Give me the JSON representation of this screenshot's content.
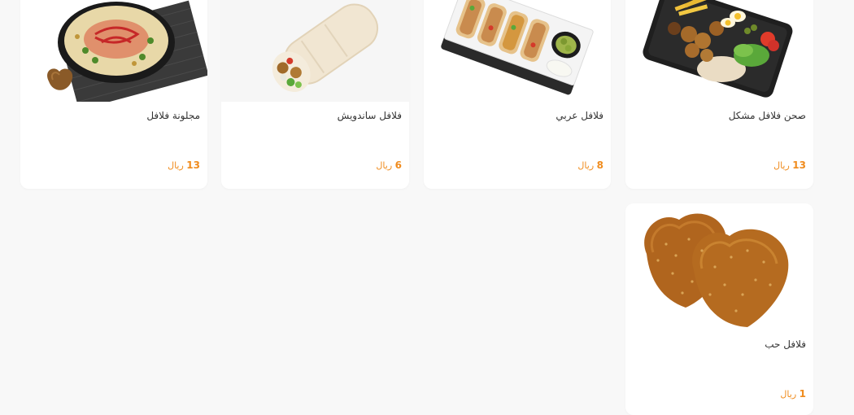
{
  "products": [
    {
      "name": "صحن فلافل مشكل",
      "price": "13",
      "currency": "ريال",
      "icon": "falafel-platter-image"
    },
    {
      "name": "فلافل عربي",
      "price": "8",
      "currency": "ريال",
      "icon": "arabic-falafel-box-image"
    },
    {
      "name": "فلافل ساندويش",
      "price": "6",
      "currency": "ريال",
      "icon": "falafel-wrap-image"
    },
    {
      "name": "مجلونة فلافل",
      "price": "13",
      "currency": "ريال",
      "icon": "falafel-bowl-image"
    },
    {
      "name": "فلافل حب",
      "price": "1",
      "currency": "ريال",
      "icon": "falafel-pieces-image"
    }
  ],
  "colors": {
    "price": "#f08c1e",
    "background": "#f8f8f8",
    "card": "#ffffff"
  }
}
